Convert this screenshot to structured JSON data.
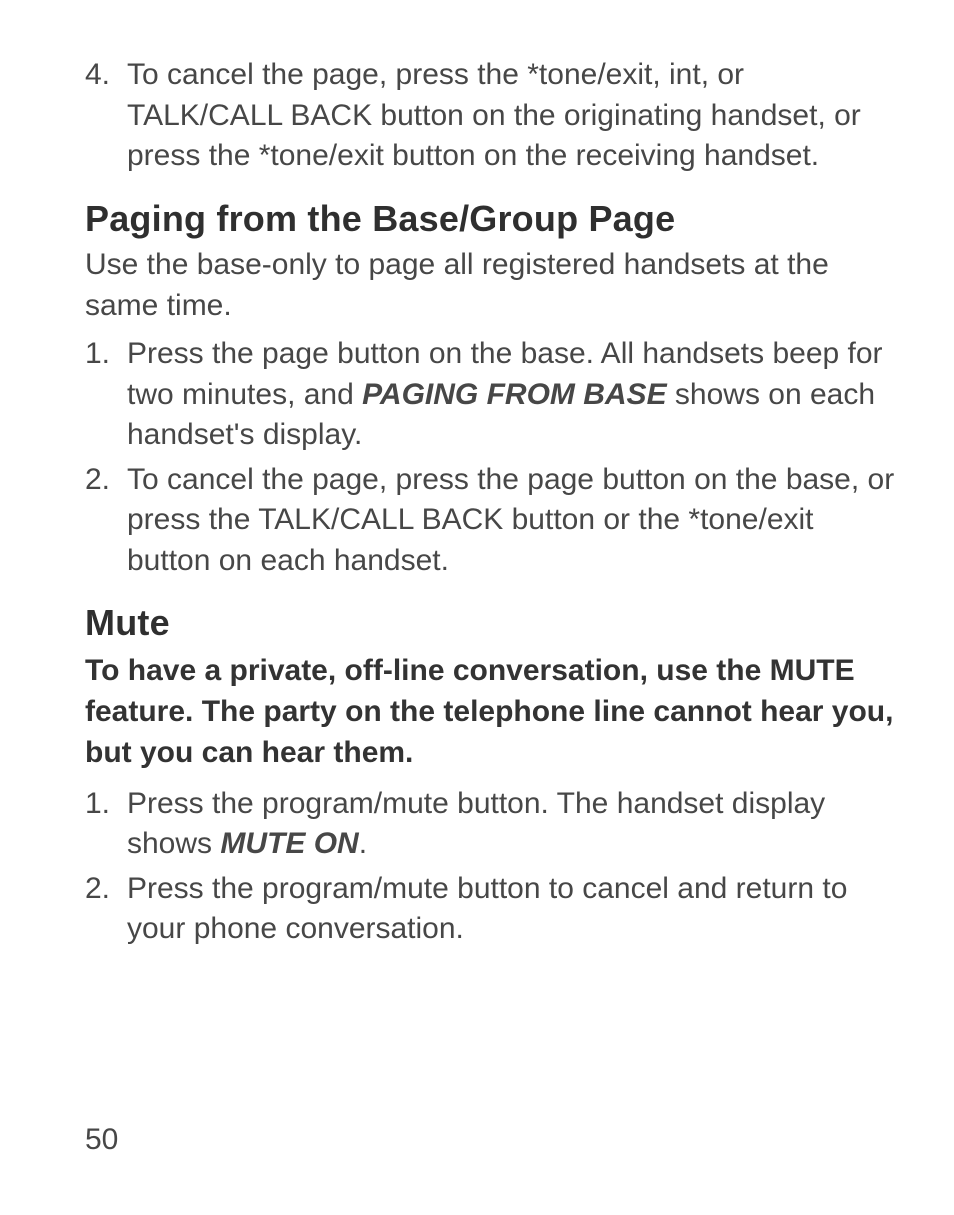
{
  "topList": {
    "item4": {
      "num": "4.",
      "text_a": "To cancel the page, press the *tone/exit, int, or TALK/CALL BACK button on the originating handset, or press the *tone/exit button on the receiving handset."
    }
  },
  "section1": {
    "heading": "Paging from the Base/Group Page",
    "lead": "Use the base-only to page all registered handsets at the same time.",
    "items": {
      "i1": {
        "num": "1.",
        "pre": "Press the page button on the base. All handsets beep for two minutes, and ",
        "strong": "PAGING FROM BASE",
        "post": " shows on each handset's display."
      },
      "i2": {
        "num": "2.",
        "text": "To cancel the page, press the page button on the base, or press the TALK/CALL BACK button or the *tone/exit button on each handset."
      }
    }
  },
  "section2": {
    "heading": "Mute",
    "sub": "To have a private, off-line conversation, use the MUTE feature. The party on the telephone line cannot hear you, but you can hear them.",
    "items": {
      "i1": {
        "num": "1.",
        "pre": "Press the program/mute button. The handset display shows ",
        "strong": "MUTE ON",
        "post": "."
      },
      "i2": {
        "num": "2.",
        "text": "Press the program/mute button to cancel and return to your phone conversation."
      }
    }
  },
  "pageNumber": "50"
}
